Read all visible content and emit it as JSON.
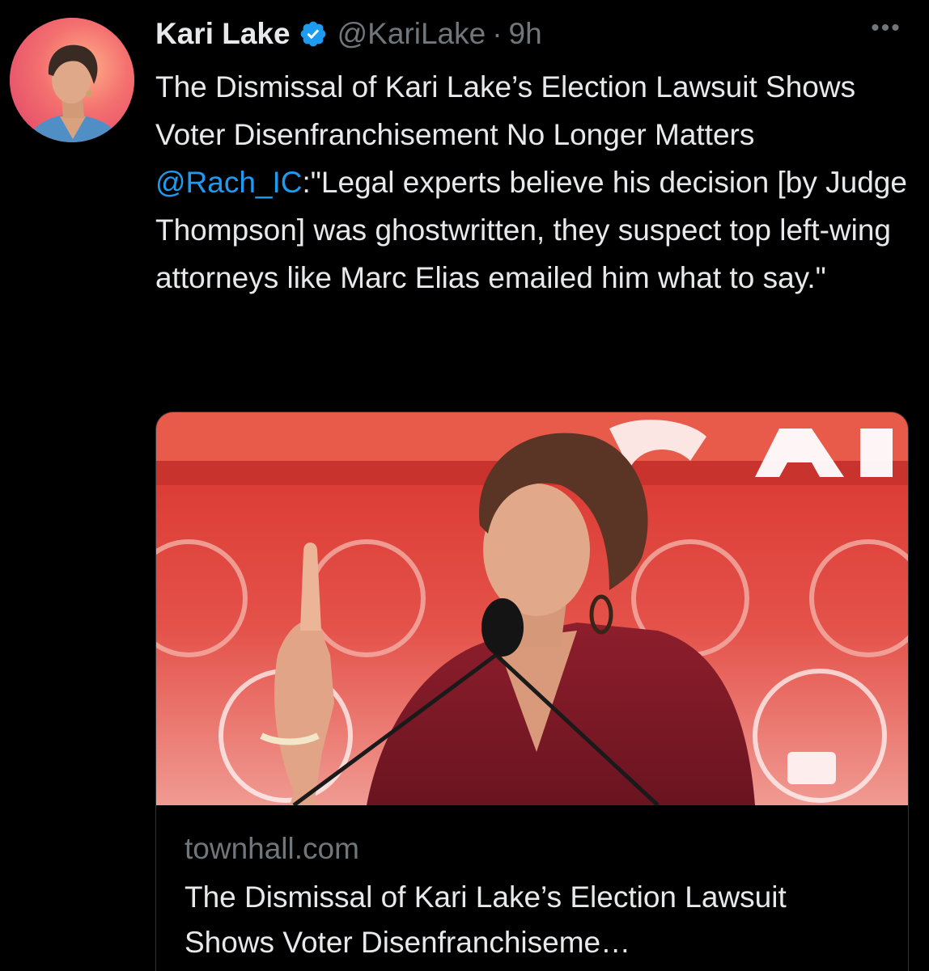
{
  "tweet": {
    "author_name": "Kari Lake",
    "verified_icon": "verified-badge-icon",
    "handle": "@KariLake",
    "separator": "·",
    "time": "9h",
    "more_icon": "more-options-icon",
    "more_label": "•••",
    "text_before_mention": "The Dismissal of Kari Lake’s Election Lawsuit Shows Voter Disenfranchisement No Longer Matters ",
    "mention": "@Rach_IC",
    "text_after_mention": ":\"Legal experts believe his decision [by Judge Thompson] was ghostwritten, they suspect top left-wing attorneys like Marc Elias emailed him what to say.\""
  },
  "card": {
    "domain": "townhall.com",
    "title": "The Dismissal of Kari Lake’s Election Lawsuit Shows Voter Disenfranchiseme…",
    "image_description_icon": "article-photo"
  },
  "colors": {
    "background": "#000000",
    "text": "#e7e9ea",
    "secondary": "#71767b",
    "link": "#1d9bf0",
    "border": "#2f3336",
    "verified": "#1d9bf0"
  }
}
